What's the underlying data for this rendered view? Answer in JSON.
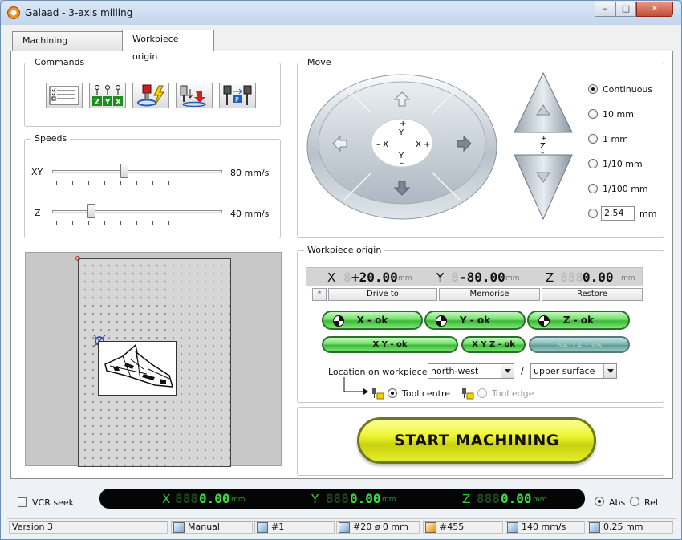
{
  "window": {
    "title": "Galaad  -  3-axis milling"
  },
  "tabs": [
    {
      "label": "Machining parameters"
    },
    {
      "label": "Workpiece origin"
    }
  ],
  "commands": {
    "label": "Commands",
    "buttons": [
      "checklist-icon",
      "zyx-axes-icon",
      "spindle-icon",
      "tool-change-icon",
      "tool-length-icon"
    ],
    "zyx_letters": [
      "Z",
      "Y",
      "X"
    ]
  },
  "speeds": {
    "label": "Speeds",
    "xy": {
      "label": "XY",
      "value_text": "80 mm/s",
      "fraction": 0.42
    },
    "z": {
      "label": "Z",
      "value_text": "40 mm/s",
      "fraction": 0.22
    }
  },
  "move": {
    "label": "Move",
    "center": {
      "plus_y": "+",
      "y_top": "Y",
      "minus_x": "– X",
      "plus_x": "X +",
      "y_bottom": "Y",
      "minus_y": "–"
    },
    "z_label": {
      "plus": "+",
      "z": "Z",
      "minus": "–"
    },
    "steps": [
      {
        "label": "Continuous",
        "selected": true
      },
      {
        "label": "10 mm",
        "selected": false
      },
      {
        "label": "1 mm",
        "selected": false
      },
      {
        "label": "1/10 mm",
        "selected": false
      },
      {
        "label": "1/100 mm",
        "selected": false
      }
    ],
    "custom": {
      "value": "2.54",
      "unit": "mm"
    }
  },
  "workpiece_origin": {
    "label": "Workpiece origin",
    "x": {
      "axis": "X",
      "ghost": "8",
      "value": "+20.00",
      "unit": "mm"
    },
    "y": {
      "axis": "Y",
      "ghost": "8",
      "value": "-80.00",
      "unit": "mm"
    },
    "z": {
      "axis": "Z",
      "ghost": "888",
      "value": "0.00",
      "unit": "mm"
    },
    "star": "*",
    "drive_to": "Drive to",
    "memorise": "Memorise",
    "restore": "Restore",
    "x_ok": "X - ok",
    "y_ok": "Y - ok",
    "z_ok": "Z - ok",
    "xy_ok": "X Y - ok",
    "xyz_ok": "X Y Z - ok",
    "x2y2_ok": "X2 Y2 - ok",
    "location_label": "Location on workpiece :",
    "location_xy": "north-west",
    "slash": "/",
    "location_z": "upper surface",
    "tool_centre": "Tool centre",
    "tool_edge": "Tool edge"
  },
  "start_button": "START  MACHINING",
  "dro": {
    "vcr_label": "VCR seek",
    "x": {
      "axis": "X",
      "ghost": "888",
      "value": "0.00",
      "unit": "mm"
    },
    "y": {
      "axis": "Y",
      "ghost": "888",
      "value": "0.00",
      "unit": "mm"
    },
    "z": {
      "axis": "Z",
      "ghost": "888",
      "value": "0.00",
      "unit": "mm"
    },
    "abs": "Abs",
    "rel": "Rel"
  },
  "statusbar": {
    "version": "Version 3",
    "mode": "Manual",
    "tool_number": "#1",
    "tool": "#20  ø 0 mm",
    "count": "#455",
    "speed": "140 mm/s",
    "step": "0.25 mm"
  },
  "colors": {
    "green_led": "#34e534",
    "start_yellow": "#eef432",
    "ok_green": "#6fe067"
  }
}
